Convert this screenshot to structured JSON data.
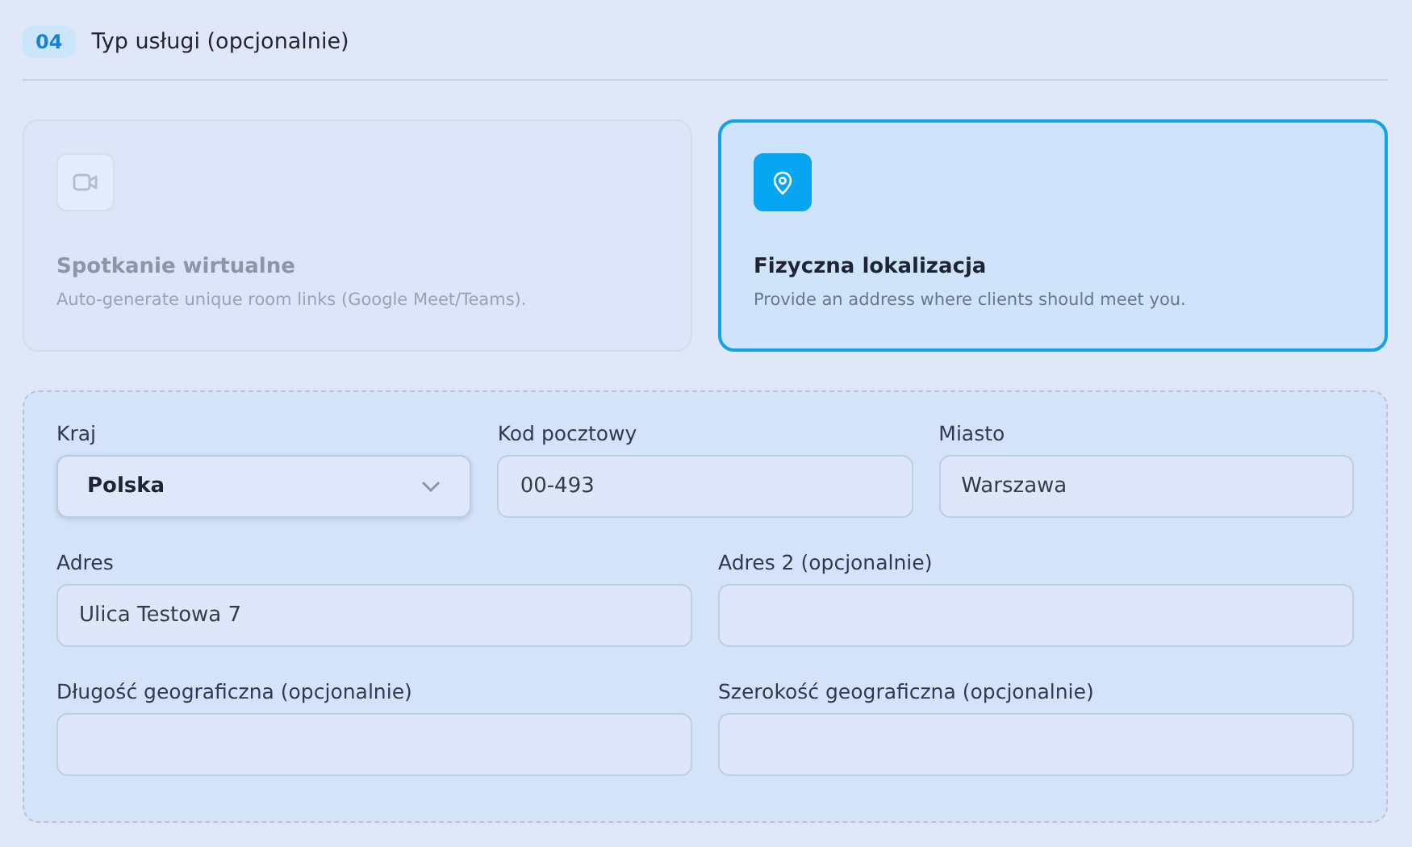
{
  "section": {
    "number": "04",
    "title": "Typ usługi (opcjonalnie)"
  },
  "options": [
    {
      "kind": "video",
      "title": "Spotkanie wirtualne",
      "description": "Auto-generate unique room links (Google Meet/Teams).",
      "selected": false
    },
    {
      "kind": "location",
      "title": "Fizyczna lokalizacja",
      "description": "Provide an address where clients should meet you.",
      "selected": true
    }
  ],
  "field_rows": [
    [
      {
        "label": "Kraj",
        "kind": "select",
        "value": "Polska"
      },
      {
        "label": "Kod pocztowy",
        "kind": "text",
        "value": "00-493"
      },
      {
        "label": "Miasto",
        "kind": "text",
        "value": "Warszawa"
      }
    ],
    [
      {
        "label": "Adres",
        "kind": "text",
        "value": "Ulica Testowa 7"
      },
      {
        "label": "Adres 2 (opcjonalnie)",
        "kind": "text"
      }
    ],
    [
      {
        "label": "Długość geograficzna (opcjonalnie)",
        "kind": "text"
      },
      {
        "label": "Szerokość geograficzna (opcjonalnie)",
        "kind": "text"
      }
    ]
  ]
}
